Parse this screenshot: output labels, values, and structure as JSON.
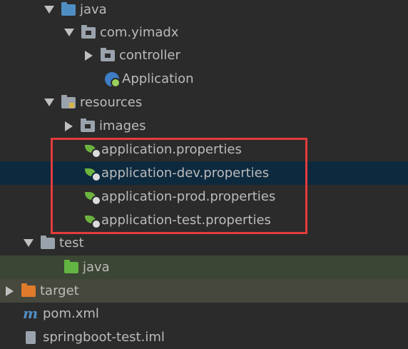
{
  "tree": [
    {
      "label": "java",
      "icon": "folder-icon",
      "expanded": true
    },
    {
      "label": "com.yimadx",
      "icon": "package-icon",
      "expanded": true
    },
    {
      "label": "controller",
      "icon": "package-icon",
      "expanded": false
    },
    {
      "label": "Application",
      "icon": "spring-boot-application-icon"
    },
    {
      "label": "resources",
      "icon": "resources-folder-icon",
      "expanded": true
    },
    {
      "label": "images",
      "icon": "folder-icon",
      "expanded": false
    },
    {
      "label": "application.properties",
      "icon": "spring-properties-icon"
    },
    {
      "label": "application-dev.properties",
      "icon": "spring-properties-icon"
    },
    {
      "label": "application-prod.properties",
      "icon": "spring-properties-icon"
    },
    {
      "label": "application-test.properties",
      "icon": "spring-properties-icon"
    },
    {
      "label": "test",
      "icon": "folder-icon",
      "expanded": true
    },
    {
      "label": "java",
      "icon": "test-folder-icon"
    },
    {
      "label": "target",
      "icon": "excluded-folder-icon",
      "expanded": false
    },
    {
      "label": "pom.xml",
      "icon": "maven-icon"
    },
    {
      "label": "springboot-test.iml",
      "icon": "iml-file-icon"
    }
  ],
  "colors": {
    "background": "#2b2b2b",
    "selected_row": "#0d293e",
    "highlight_border": "#e23c3c"
  }
}
